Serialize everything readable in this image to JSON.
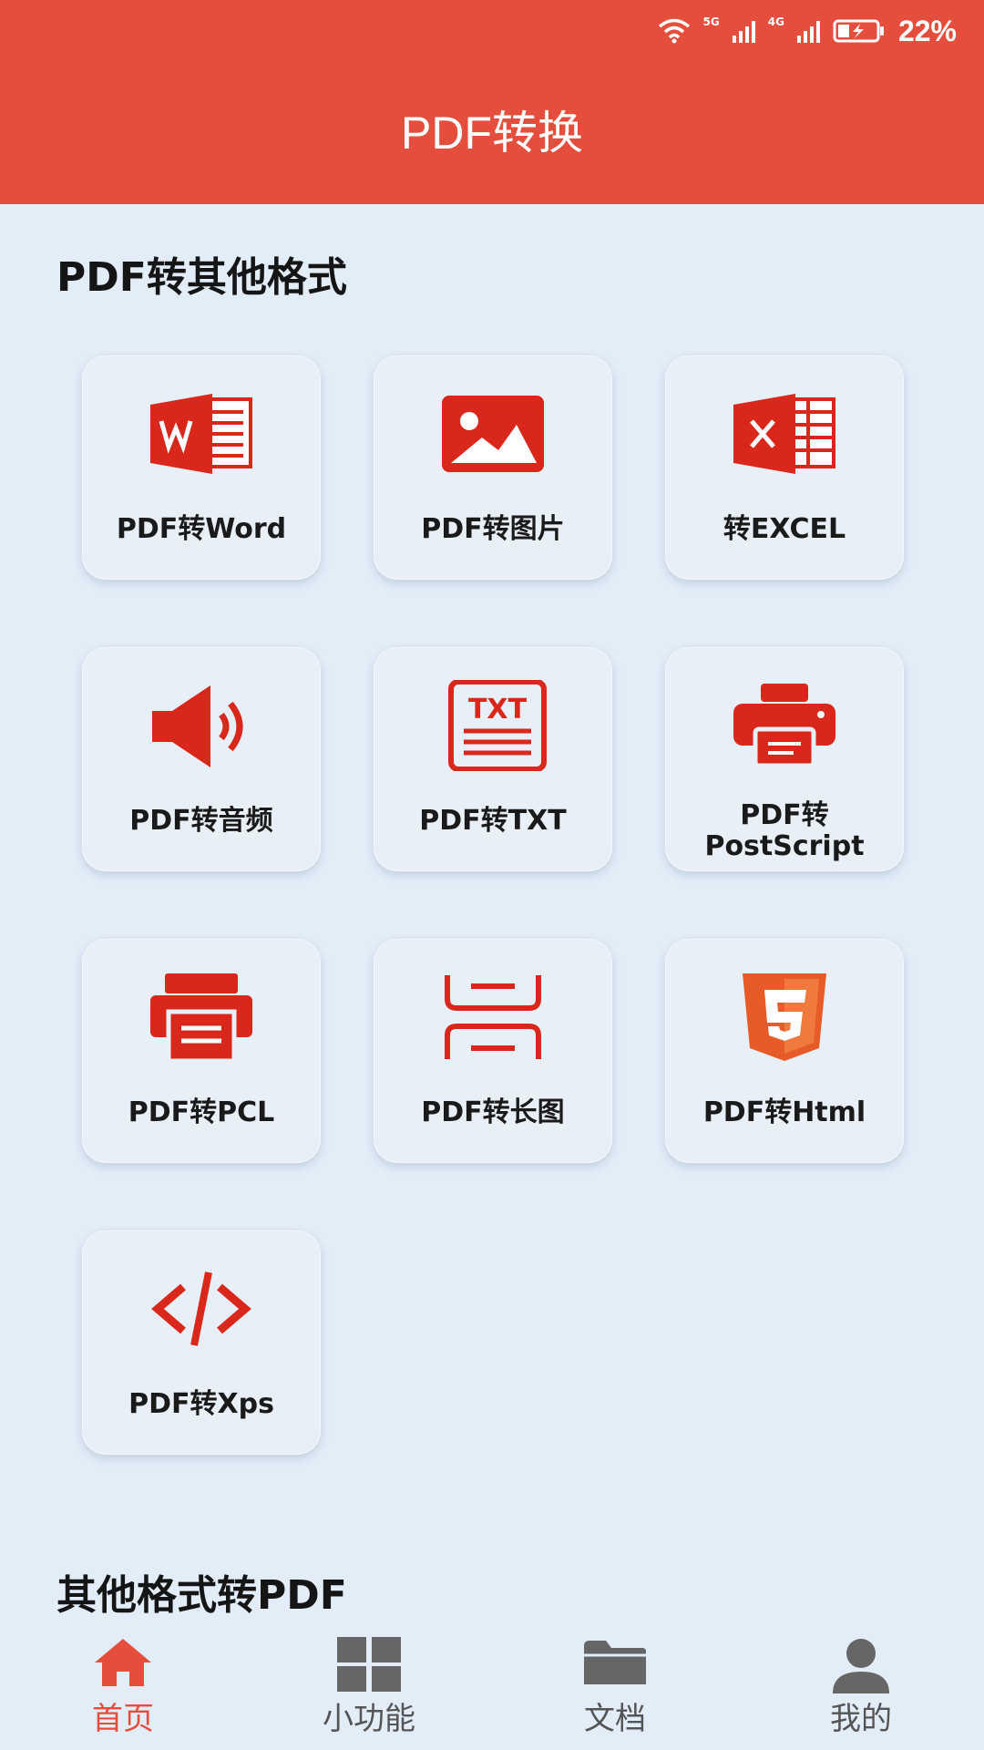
{
  "status_bar": {
    "network_1": "5G",
    "network_2": "4G",
    "battery": "22%"
  },
  "header": {
    "title": "PDF转换"
  },
  "sections": [
    {
      "title": "PDF转其他格式"
    },
    {
      "title": "其他格式转PDF"
    }
  ],
  "tools": [
    {
      "label": "PDF转Word",
      "icon": "word-icon"
    },
    {
      "label": "PDF转图片",
      "icon": "image-icon"
    },
    {
      "label": "转EXCEL",
      "icon": "excel-icon"
    },
    {
      "label": "PDF转音频",
      "icon": "speaker-icon"
    },
    {
      "label": "PDF转TXT",
      "icon": "txt-icon"
    },
    {
      "label": "PDF转",
      "label_2": "PostScript",
      "icon": "printer-icon"
    },
    {
      "label": "PDF转PCL",
      "icon": "pcl-printer-icon"
    },
    {
      "label": "PDF转长图",
      "icon": "long-image-icon"
    },
    {
      "label": "PDF转Html",
      "icon": "html5-icon"
    },
    {
      "label": "PDF转Xps",
      "icon": "code-icon"
    }
  ],
  "tabbar": {
    "items": [
      {
        "label": "首页",
        "icon": "home-icon",
        "active": true
      },
      {
        "label": "小功能",
        "icon": "grid-icon",
        "active": false
      },
      {
        "label": "文档",
        "icon": "folder-icon",
        "active": false
      },
      {
        "label": "我的",
        "icon": "user-icon",
        "active": false
      }
    ]
  },
  "colors": {
    "accent": "#e54e3c",
    "icon_red": "#d9271c",
    "html5_orange": "#e65b28",
    "background": "#e3edf8",
    "inactive_tab": "#555555"
  }
}
